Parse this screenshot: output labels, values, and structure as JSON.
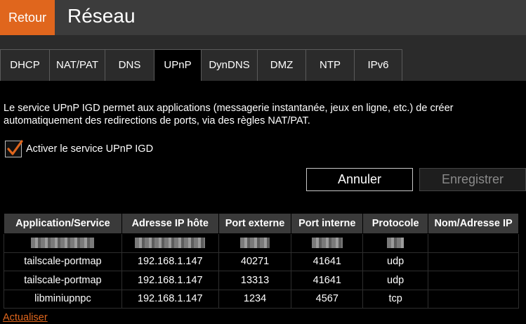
{
  "header": {
    "back_label": "Retour",
    "title": "Réseau"
  },
  "tabs": [
    {
      "label": "DHCP",
      "active": false
    },
    {
      "label": "NAT/PAT",
      "active": false
    },
    {
      "label": "DNS",
      "active": false
    },
    {
      "label": "UPnP",
      "active": true
    },
    {
      "label": "DynDNS",
      "active": false
    },
    {
      "label": "DMZ",
      "active": false
    },
    {
      "label": "NTP",
      "active": false
    },
    {
      "label": "IPv6",
      "active": false
    }
  ],
  "description": "Le service UPnP IGD permet aux applications (messagerie instantanée, jeux en ligne, etc.) de créer automatiquement des redirections de ports, via des règles NAT/PAT.",
  "upnp_checkbox": {
    "label": "Activer le service UPnP IGD",
    "checked": true
  },
  "buttons": {
    "cancel_label": "Annuler",
    "save_label": "Enregistrer"
  },
  "table": {
    "headers": [
      "Application/Service",
      "Adresse IP hôte",
      "Port externe",
      "Port interne",
      "Protocole",
      "Nom/Adresse IP"
    ],
    "rows": [
      [
        "tailscale-portmap",
        "192.168.1.147",
        "40271",
        "41641",
        "udp",
        ""
      ],
      [
        "tailscale-portmap",
        "192.168.1.147",
        "13313",
        "41641",
        "udp",
        ""
      ],
      [
        "libminiupnpc",
        "192.168.1.147",
        "1234",
        "4567",
        "tcp",
        ""
      ]
    ]
  },
  "refresh_label": "Actualiser",
  "colors": {
    "accent": "#e0661d",
    "header_bg": "#3c3c3c",
    "tabs_bg": "#2b2b2b"
  }
}
